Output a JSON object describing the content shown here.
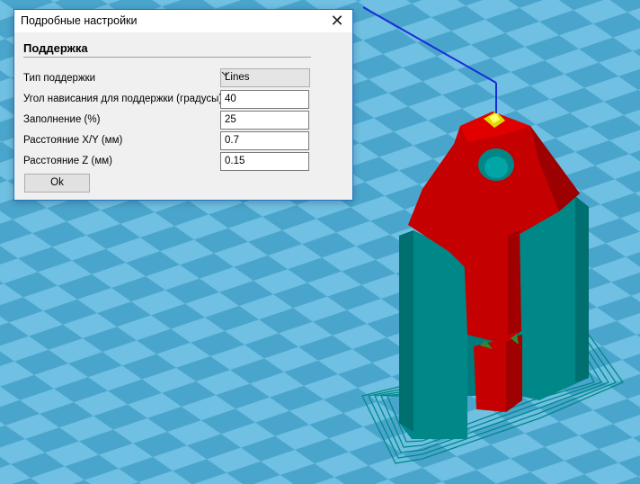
{
  "window": {
    "title": "Подробные настройки",
    "close_glyph": "✕"
  },
  "support_section": {
    "header": "Поддержка",
    "rows": [
      {
        "label": "Тип поддержки",
        "value": "Lines",
        "kind": "select"
      },
      {
        "label": "Угол нависания для поддержки (градусы)",
        "value": "40",
        "kind": "input"
      },
      {
        "label": "Заполнение (%)",
        "value": "25",
        "kind": "input"
      },
      {
        "label": "Расстояние X/Y (мм)",
        "value": "0.7",
        "kind": "input"
      },
      {
        "label": "Расстояние Z (мм)",
        "value": "0.15",
        "kind": "input"
      }
    ]
  },
  "buttons": {
    "ok_label": "Ok"
  },
  "icons": {
    "close": "close-icon",
    "dropdown": "chevron-down-icon"
  },
  "colors": {
    "floor_light": "#6fc0e2",
    "floor_dark": "#4aa5cd",
    "support": "#008888",
    "model": "#c40000",
    "highlight": "#dddd00",
    "axis_line": "#1a2ad8"
  }
}
